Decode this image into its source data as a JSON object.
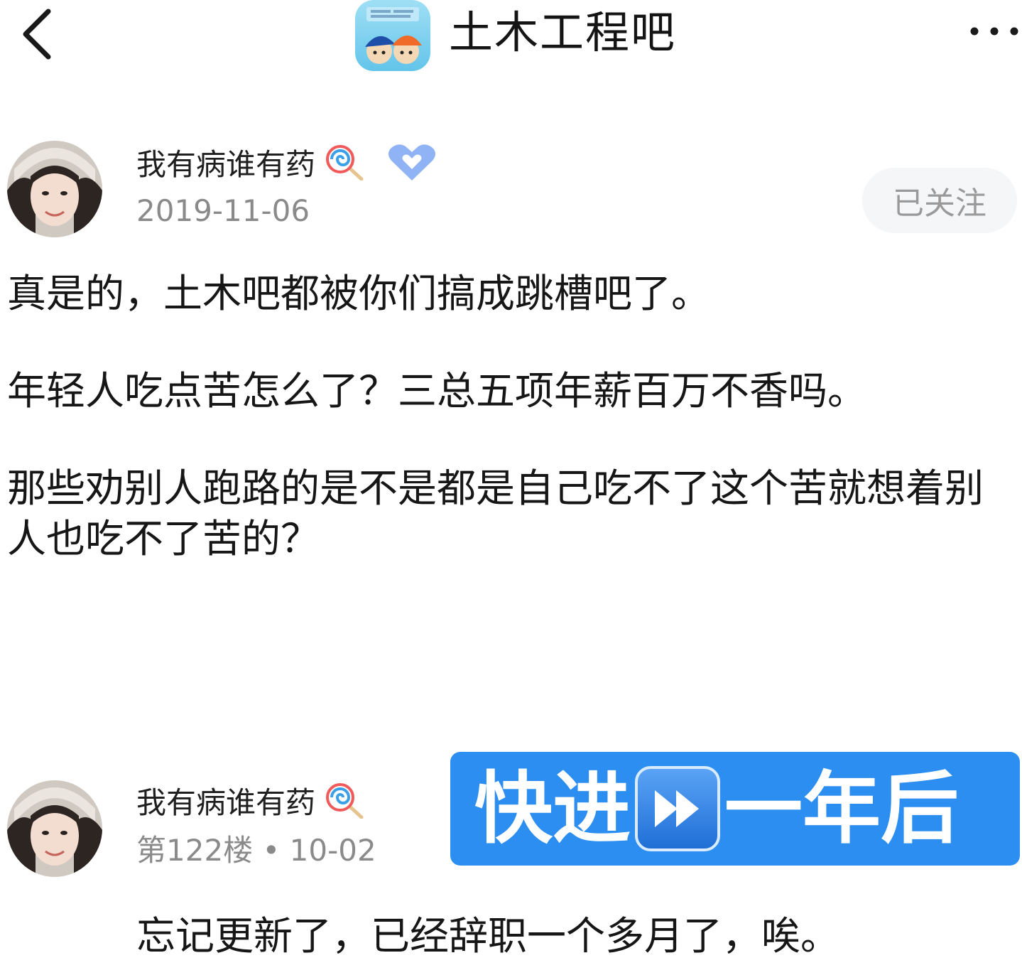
{
  "header": {
    "forum_title": "土木工程吧"
  },
  "post": {
    "author": "我有病谁有药",
    "date": "2019-11-06",
    "follow_label": "已关注",
    "paragraphs": [
      "真是的，土木吧都被你们搞成跳槽吧了。",
      "年轻人吃点苦怎么了？三总五项年薪百万不香吗。",
      "那些劝别人跑路的是不是都是自己吃不了这个苦就想着别人也吃不了苦的？"
    ]
  },
  "reply": {
    "author": "我有病谁有药",
    "floor": "第122楼",
    "date": "10-02",
    "text": "忘记更新了，已经辞职一个多月了，唉。"
  },
  "banner": {
    "text_before": "快进",
    "text_after": "一年后",
    "color": "#2b8ef0"
  },
  "icons": {
    "back": "chevron-left-icon",
    "more": "more-dots-icon",
    "lollipop": "lollipop-emoji-icon",
    "heart": "heart-badge-icon",
    "fast_forward": "fast-forward-icon"
  }
}
